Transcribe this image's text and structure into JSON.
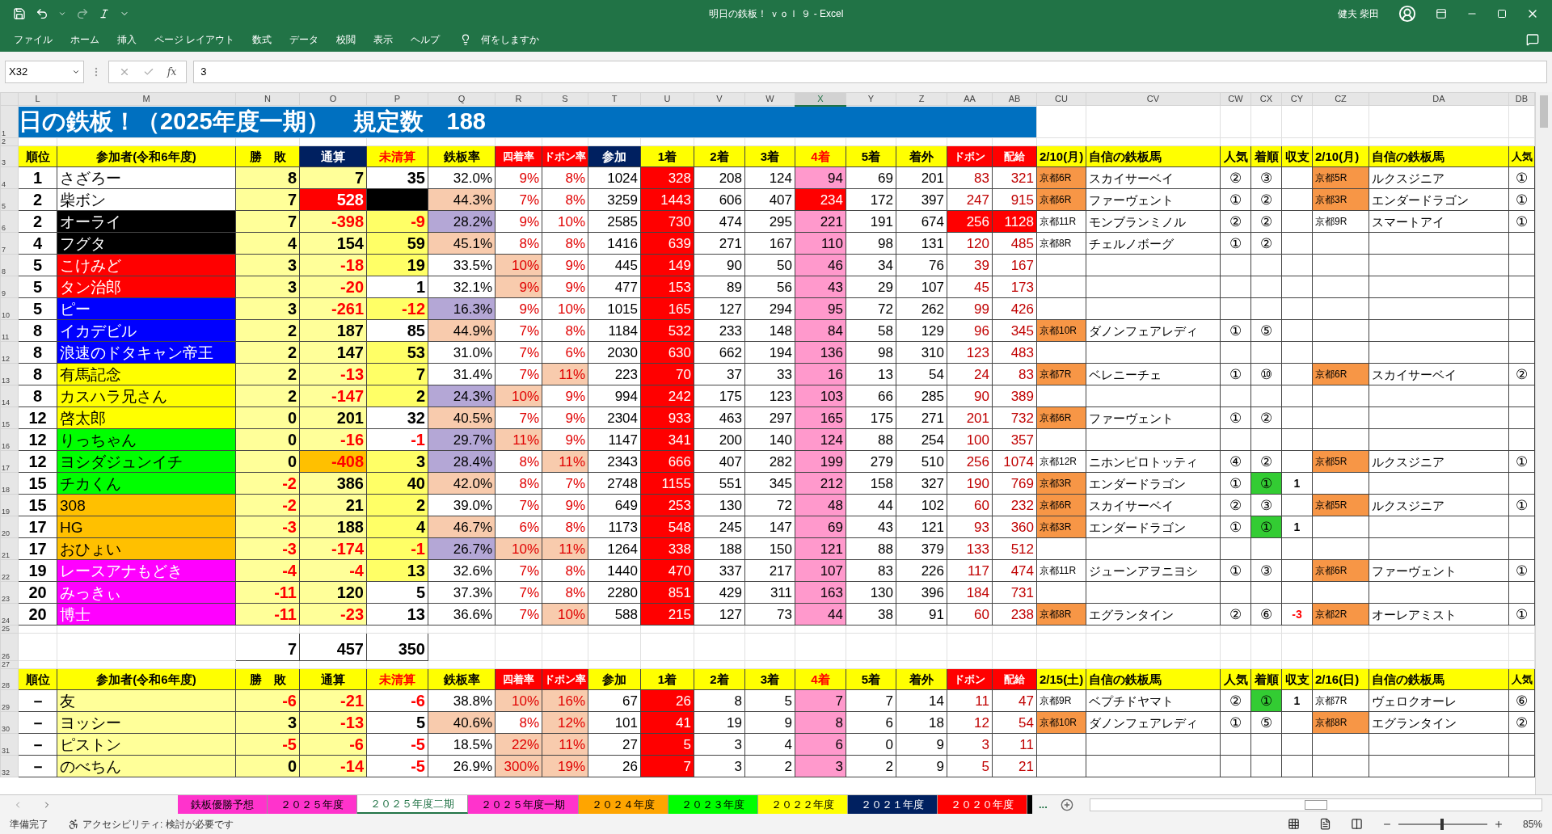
{
  "window": {
    "title": "明日の鉄板！ ｖｏｌ ９ - Excel",
    "user": "健夫 柴田"
  },
  "menu": [
    "ファイル",
    "ホーム",
    "挿入",
    "ページ レイアウト",
    "数式",
    "データ",
    "校閲",
    "表示",
    "ヘルプ"
  ],
  "tell_me": "何をしますか",
  "formula_bar": {
    "name_box": "X32",
    "fx": "fx",
    "value": "3"
  },
  "columns": [
    {
      "label": "L",
      "selected": false
    },
    {
      "label": "M",
      "selected": false
    },
    {
      "label": "N",
      "selected": false
    },
    {
      "label": "O",
      "selected": false
    },
    {
      "label": "P",
      "selected": false
    },
    {
      "label": "Q",
      "selected": false
    },
    {
      "label": "R",
      "selected": false
    },
    {
      "label": "S",
      "selected": false
    },
    {
      "label": "T",
      "selected": false
    },
    {
      "label": "U",
      "selected": false
    },
    {
      "label": "V",
      "selected": false
    },
    {
      "label": "W",
      "selected": false
    },
    {
      "label": "X",
      "selected": true
    },
    {
      "label": "Y",
      "selected": false
    },
    {
      "label": "Z",
      "selected": false
    },
    {
      "label": "AA",
      "selected": false
    },
    {
      "label": "AB",
      "selected": false
    },
    {
      "label": "CU",
      "selected": false
    },
    {
      "label": "CV",
      "selected": false
    },
    {
      "label": "CW",
      "selected": false
    },
    {
      "label": "CX",
      "selected": false
    },
    {
      "label": "CY",
      "selected": false
    },
    {
      "label": "CZ",
      "selected": false
    },
    {
      "label": "DA",
      "selected": false
    },
    {
      "label": "DB",
      "selected": false
    }
  ],
  "row_numbers": [
    "1",
    "2",
    "3",
    "4",
    "5",
    "6",
    "7",
    "8",
    "9",
    "10",
    "11",
    "12",
    "13",
    "14",
    "15",
    "16",
    "17",
    "18",
    "19",
    "20",
    "21",
    "22",
    "23",
    "24",
    "25",
    "26",
    "27",
    "28",
    "29",
    "30",
    "31",
    "32"
  ],
  "banner": "日の鉄板！（2025年度一期）　規定数　188",
  "header": [
    {
      "text": "順位",
      "color": "#ffff00",
      "accent": false
    },
    {
      "text": "参加者(令和6年度)",
      "color": "#ffff00",
      "accent": false
    },
    {
      "text": "勝　敗",
      "color": "#ffff00",
      "accent": false
    },
    {
      "text": "通算",
      "color": "#002060",
      "accent": false
    },
    {
      "text": "未清算",
      "color": "#ffff00",
      "accent": true
    },
    {
      "text": "鉄板率",
      "color": "#ffff00",
      "accent": false
    },
    {
      "text": "四着率",
      "color": "#ff0000",
      "accent": false
    },
    {
      "text": "ドボン率",
      "color": "#ff0000",
      "accent": false
    },
    {
      "text": "参加",
      "color": "#002060",
      "accent": false
    },
    {
      "text": "1着",
      "color": "#ffff00",
      "accent": false
    },
    {
      "text": "2着",
      "color": "#ffff00",
      "accent": false
    },
    {
      "text": "3着",
      "color": "#ffff00",
      "accent": false
    },
    {
      "text": "4着",
      "color": "#ffff00",
      "accent": true
    },
    {
      "text": "5着",
      "color": "#ffff00",
      "accent": false
    },
    {
      "text": "着外",
      "color": "#ffff00",
      "accent": false
    },
    {
      "text": "ドボン",
      "color": "#ff0000",
      "accent": false
    },
    {
      "text": "配給",
      "color": "#ff0000",
      "accent": false
    },
    {
      "text": "2/10(月)",
      "color": "#ffff00",
      "accent": false
    },
    {
      "text": "自信の鉄板馬",
      "color": "#ffff00",
      "accent": false
    },
    {
      "text": "人気",
      "color": "#ffff00",
      "accent": false
    },
    {
      "text": "着順",
      "color": "#ffff00",
      "accent": false
    },
    {
      "text": "収支",
      "color": "#ffff00",
      "accent": false
    },
    {
      "text": "2/10(月)",
      "color": "#ffff00",
      "accent": false
    },
    {
      "text": "自信の鉄板馬",
      "color": "#ffff00",
      "accent": false
    },
    {
      "text": "人気",
      "color": "#ffff00",
      "accent": false
    }
  ],
  "rows": [
    {
      "rank": "1",
      "name": {
        "text": "さざろー",
        "color": "#ffffff"
      },
      "win_loss": "8",
      "total": {
        "text": "7",
        "color": "#ffff99"
      },
      "unsettled": {
        "text": "35",
        "color": "#ffffff"
      },
      "rate": {
        "text": "32.0%",
        "color": "#ffffff"
      },
      "fourth_rate": {
        "text": "9%",
        "color": "#ffffff"
      },
      "dobon_rate": {
        "text": "8%",
        "color": "#ffffff"
      },
      "entries": "1024",
      "first": "328",
      "second": "208",
      "third": "124",
      "fourth": {
        "text": "94",
        "color": "#ff99cc"
      },
      "fifth": "69",
      "out": "201",
      "dobon": {
        "text": "83",
        "color": "#ffffff"
      },
      "payout": {
        "text": "321",
        "color": "#ffffff"
      },
      "picks": [
        {
          "race": {
            "text": "京都6R",
            "color": "#f79646"
          },
          "horse": "スカイサーベイ",
          "pop": "②",
          "result": {
            "text": "③",
            "color": "#ffffff"
          }
        },
        {
          "race": {
            "text": "京都5R",
            "color": "#f79646"
          },
          "horse": "ルクスジニア",
          "pop": "①"
        }
      ]
    },
    {
      "rank": "2",
      "name": {
        "text": "柴ボン",
        "color": "#ffffff"
      },
      "win_loss": "7",
      "total": {
        "text": "528",
        "color": "#ff0000"
      },
      "unsettled": {
        "color": "#000000"
      },
      "rate": {
        "text": "44.3%",
        "color": "#f8cbad"
      },
      "fourth_rate": {
        "text": "7%",
        "color": "#ffffff"
      },
      "dobon_rate": {
        "text": "8%",
        "color": "#ffffff"
      },
      "entries": "3259",
      "first": "1443",
      "second": "606",
      "third": "407",
      "fourth": {
        "text": "234",
        "color": "#ff0000"
      },
      "fifth": "172",
      "out": "397",
      "dobon": {
        "text": "247",
        "color": "#ffffff"
      },
      "payout": {
        "text": "915",
        "color": "#ffffff"
      },
      "picks": [
        {
          "race": {
            "text": "京都6R",
            "color": "#f79646"
          },
          "horse": "ファーヴェント",
          "pop": "①",
          "result": {
            "text": "②",
            "color": "#ffffff"
          }
        },
        {
          "race": {
            "text": "京都3R",
            "color": "#f79646"
          },
          "horse": "エンダードラゴン",
          "pop": "①"
        }
      ]
    },
    {
      "rank": "2",
      "name": {
        "text": "オーライ",
        "color": "#000000"
      },
      "win_loss": "7",
      "total": {
        "text": "-398",
        "color": "#ffff99"
      },
      "unsettled": {
        "text": "-9",
        "color": "#ffff66"
      },
      "rate": {
        "text": "28.2%",
        "color": "#b4a7d6"
      },
      "fourth_rate": {
        "text": "9%",
        "color": "#ffffff"
      },
      "dobon_rate": {
        "text": "10%",
        "color": "#ffffff"
      },
      "entries": "2585",
      "first": "730",
      "second": "474",
      "third": "295",
      "fourth": {
        "text": "221",
        "color": "#ff99cc"
      },
      "fifth": "191",
      "out": "674",
      "dobon": {
        "text": "256",
        "color": "#ff0000"
      },
      "payout": {
        "text": "1128",
        "color": "#ff0000"
      },
      "picks": [
        {
          "race": {
            "text": "京都11R",
            "color": "#ffffff"
          },
          "horse": "モンブランミノル",
          "pop": "②",
          "result": {
            "text": "②",
            "color": "#ffffff"
          }
        },
        {
          "race": {
            "text": "京都9R",
            "color": "#ffffff"
          },
          "horse": "スマートアイ",
          "pop": "①"
        }
      ]
    },
    {
      "rank": "4",
      "name": {
        "text": "フグタ",
        "color": "#000000"
      },
      "win_loss": "4",
      "total": {
        "text": "154",
        "color": "#ffff99"
      },
      "unsettled": {
        "text": "59",
        "color": "#ffff66"
      },
      "rate": {
        "text": "45.1%",
        "color": "#f8cbad"
      },
      "fourth_rate": {
        "text": "8%",
        "color": "#ffffff"
      },
      "dobon_rate": {
        "text": "8%",
        "color": "#ffffff"
      },
      "entries": "1416",
      "first": "639",
      "second": "271",
      "third": "167",
      "fourth": {
        "text": "110",
        "color": "#ff99cc"
      },
      "fifth": "98",
      "out": "131",
      "dobon": {
        "text": "120",
        "color": "#ffffff"
      },
      "payout": {
        "text": "485",
        "color": "#ffffff"
      },
      "picks": [
        {
          "race": {
            "text": "京都8R",
            "color": "#ffffff"
          },
          "horse": "チェルノボーグ",
          "pop": "①",
          "result": {
            "text": "②",
            "color": "#ffffff"
          }
        }
      ]
    },
    {
      "rank": "5",
      "name": {
        "text": "こけみど",
        "color": "#ff0000"
      },
      "win_loss": "3",
      "total": {
        "text": "-18",
        "color": "#ffff99"
      },
      "unsettled": {
        "text": "19",
        "color": "#ffff66"
      },
      "rate": {
        "text": "33.5%",
        "color": "#ffffff"
      },
      "fourth_rate": {
        "text": "10%",
        "color": "#f8cbad"
      },
      "dobon_rate": {
        "text": "9%",
        "color": "#ffffff"
      },
      "entries": "445",
      "first": "149",
      "second": "90",
      "third": "50",
      "fourth": {
        "text": "46",
        "color": "#ff99cc"
      },
      "fifth": "34",
      "out": "76",
      "dobon": {
        "text": "39",
        "color": "#ffffff"
      },
      "payout": {
        "text": "167",
        "color": "#ffffff"
      }
    },
    {
      "rank": "5",
      "name": {
        "text": "タン治郎",
        "color": "#ff0000"
      },
      "win_loss": "3",
      "total": {
        "text": "-20",
        "color": "#ffff99"
      },
      "unsettled": {
        "text": "1",
        "color": "#ffffff"
      },
      "rate": {
        "text": "32.1%",
        "color": "#ffffff"
      },
      "fourth_rate": {
        "text": "9%",
        "color": "#f8cbad"
      },
      "dobon_rate": {
        "text": "9%",
        "color": "#ffffff"
      },
      "entries": "477",
      "first": "153",
      "second": "89",
      "third": "56",
      "fourth": {
        "text": "43",
        "color": "#ff99cc"
      },
      "fifth": "29",
      "out": "107",
      "dobon": {
        "text": "45",
        "color": "#ffffff"
      },
      "payout": {
        "text": "173",
        "color": "#ffffff"
      }
    },
    {
      "rank": "5",
      "name": {
        "text": "ピー",
        "color": "#0000ff"
      },
      "win_loss": "3",
      "total": {
        "text": "-261",
        "color": "#ffff99"
      },
      "unsettled": {
        "text": "-12",
        "color": "#ffff66"
      },
      "rate": {
        "text": "16.3%",
        "color": "#b4a7d6"
      },
      "fourth_rate": {
        "text": "9%",
        "color": "#ffffff"
      },
      "dobon_rate": {
        "text": "10%",
        "color": "#ffffff"
      },
      "entries": "1015",
      "first": "165",
      "second": "127",
      "third": "294",
      "fourth": {
        "text": "95",
        "color": "#ff99cc"
      },
      "fifth": "72",
      "out": "262",
      "dobon": {
        "text": "99",
        "color": "#ffffff"
      },
      "payout": {
        "text": "426",
        "color": "#ffffff"
      }
    },
    {
      "rank": "8",
      "name": {
        "text": "イカデビル",
        "color": "#0000ff"
      },
      "win_loss": "2",
      "total": {
        "text": "187",
        "color": "#ffff99"
      },
      "unsettled": {
        "text": "85",
        "color": "#ffffff"
      },
      "rate": {
        "text": "44.9%",
        "color": "#f8cbad"
      },
      "fourth_rate": {
        "text": "7%",
        "color": "#ffffff"
      },
      "dobon_rate": {
        "text": "8%",
        "color": "#ffffff"
      },
      "entries": "1184",
      "first": "532",
      "second": "233",
      "third": "148",
      "fourth": {
        "text": "84",
        "color": "#ff99cc"
      },
      "fifth": "58",
      "out": "129",
      "dobon": {
        "text": "96",
        "color": "#ffffff"
      },
      "payout": {
        "text": "345",
        "color": "#ffffff"
      },
      "picks": [
        {
          "race": {
            "text": "京都10R",
            "color": "#f79646"
          },
          "horse": "ダノンフェアレディ",
          "pop": "①",
          "result": {
            "text": "⑤",
            "color": "#ffffff"
          }
        }
      ]
    },
    {
      "rank": "8",
      "name": {
        "text": "浪速のドタキャン帝王",
        "color": "#0000ff"
      },
      "win_loss": "2",
      "total": {
        "text": "147",
        "color": "#ffff99"
      },
      "unsettled": {
        "text": "53",
        "color": "#ffff66"
      },
      "rate": {
        "text": "31.0%",
        "color": "#ffffff"
      },
      "fourth_rate": {
        "text": "7%",
        "color": "#ffffff"
      },
      "dobon_rate": {
        "text": "6%",
        "color": "#ffffff"
      },
      "entries": "2030",
      "first": "630",
      "second": "662",
      "third": "194",
      "fourth": {
        "text": "136",
        "color": "#ff99cc"
      },
      "fifth": "98",
      "out": "310",
      "dobon": {
        "text": "123",
        "color": "#ffffff"
      },
      "payout": {
        "text": "483",
        "color": "#ffffff"
      }
    },
    {
      "rank": "8",
      "name": {
        "text": "有馬記念",
        "color": "#ffff00"
      },
      "win_loss": "2",
      "total": {
        "text": "-13",
        "color": "#ffff99"
      },
      "unsettled": {
        "text": "7",
        "color": "#ffff66"
      },
      "rate": {
        "text": "31.4%",
        "color": "#ffffff"
      },
      "fourth_rate": {
        "text": "7%",
        "color": "#ffffff"
      },
      "dobon_rate": {
        "text": "11%",
        "color": "#f8cbad"
      },
      "entries": "223",
      "first": "70",
      "second": "37",
      "third": "33",
      "fourth": {
        "text": "16",
        "color": "#ff99cc"
      },
      "fifth": "13",
      "out": "54",
      "dobon": {
        "text": "24",
        "color": "#ffffff"
      },
      "payout": {
        "text": "83",
        "color": "#ffffff"
      },
      "picks": [
        {
          "race": {
            "text": "京都7R",
            "color": "#f79646"
          },
          "horse": "ベレニーチェ",
          "pop": "①",
          "result": {
            "text": "⑩",
            "color": "#ffffff"
          }
        },
        {
          "race": {
            "text": "京都6R",
            "color": "#f79646"
          },
          "horse": "スカイサーベイ",
          "pop": "②"
        }
      ]
    },
    {
      "rank": "8",
      "name": {
        "text": "カスハラ兄さん",
        "color": "#ffff00"
      },
      "win_loss": "2",
      "total": {
        "text": "-147",
        "color": "#ffff99"
      },
      "unsettled": {
        "text": "2",
        "color": "#ffff66"
      },
      "rate": {
        "text": "24.3%",
        "color": "#b4a7d6"
      },
      "fourth_rate": {
        "text": "10%",
        "color": "#f8cbad"
      },
      "dobon_rate": {
        "text": "9%",
        "color": "#ffffff"
      },
      "entries": "994",
      "first": "242",
      "second": "175",
      "third": "123",
      "fourth": {
        "text": "103",
        "color": "#ff99cc"
      },
      "fifth": "66",
      "out": "285",
      "dobon": {
        "text": "90",
        "color": "#ffffff"
      },
      "payout": {
        "text": "389",
        "color": "#ffffff"
      }
    },
    {
      "rank": "12",
      "name": {
        "text": "啓太郎",
        "color": "#ffff00"
      },
      "win_loss": "0",
      "total": {
        "text": "201",
        "color": "#ffff99"
      },
      "unsettled": {
        "text": "32",
        "color": "#ffffff"
      },
      "rate": {
        "text": "40.5%",
        "color": "#f8cbad"
      },
      "fourth_rate": {
        "text": "7%",
        "color": "#ffffff"
      },
      "dobon_rate": {
        "text": "9%",
        "color": "#ffffff"
      },
      "entries": "2304",
      "first": "933",
      "second": "463",
      "third": "297",
      "fourth": {
        "text": "165",
        "color": "#ff99cc"
      },
      "fifth": "175",
      "out": "271",
      "dobon": {
        "text": "201",
        "color": "#ffffff"
      },
      "payout": {
        "text": "732",
        "color": "#ffffff"
      },
      "picks": [
        {
          "race": {
            "text": "京都6R",
            "color": "#f79646"
          },
          "horse": "ファーヴェント",
          "pop": "①",
          "result": {
            "text": "②",
            "color": "#ffffff"
          }
        }
      ]
    },
    {
      "rank": "12",
      "name": {
        "text": "りっちゃん",
        "color": "#00ff00"
      },
      "win_loss": "0",
      "total": {
        "text": "-16",
        "color": "#ffff99"
      },
      "unsettled": {
        "text": "-1",
        "color": "#ffffff"
      },
      "rate": {
        "text": "29.7%",
        "color": "#b4a7d6"
      },
      "fourth_rate": {
        "text": "11%",
        "color": "#f8cbad"
      },
      "dobon_rate": {
        "text": "9%",
        "color": "#ffffff"
      },
      "entries": "1147",
      "first": "341",
      "second": "200",
      "third": "140",
      "fourth": {
        "text": "124",
        "color": "#ff99cc"
      },
      "fifth": "88",
      "out": "254",
      "dobon": {
        "text": "100",
        "color": "#ffffff"
      },
      "payout": {
        "text": "357",
        "color": "#ffffff"
      }
    },
    {
      "rank": "12",
      "name": {
        "text": "ヨシダジュンイチ",
        "color": "#00ff00"
      },
      "win_loss": "0",
      "total": {
        "text": "-408",
        "color": "#ffc000"
      },
      "unsettled": {
        "text": "3",
        "color": "#ffff66"
      },
      "rate": {
        "text": "28.4%",
        "color": "#b4a7d6"
      },
      "fourth_rate": {
        "text": "8%",
        "color": "#ffffff"
      },
      "dobon_rate": {
        "text": "11%",
        "color": "#f8cbad"
      },
      "entries": "2343",
      "first": "666",
      "second": "407",
      "third": "282",
      "fourth": {
        "text": "199",
        "color": "#ff99cc"
      },
      "fifth": "279",
      "out": "510",
      "dobon": {
        "text": "256",
        "color": "#ffffff"
      },
      "payout": {
        "text": "1074",
        "color": "#ffffff"
      },
      "picks": [
        {
          "race": {
            "text": "京都12R",
            "color": "#ffffff"
          },
          "horse": "ニホンピロトッティ",
          "pop": "④",
          "result": {
            "text": "②",
            "color": "#ffffff"
          }
        },
        {
          "race": {
            "text": "京都5R",
            "color": "#f79646"
          },
          "horse": "ルクスジニア",
          "pop": "①"
        }
      ]
    },
    {
      "rank": "15",
      "name": {
        "text": "チカくん",
        "color": "#00ff00"
      },
      "win_loss": "-2",
      "total": {
        "text": "386",
        "color": "#ffff99"
      },
      "unsettled": {
        "text": "40",
        "color": "#ffff66"
      },
      "rate": {
        "text": "42.0%",
        "color": "#f8cbad"
      },
      "fourth_rate": {
        "text": "8%",
        "color": "#ffffff"
      },
      "dobon_rate": {
        "text": "7%",
        "color": "#ffffff"
      },
      "entries": "2748",
      "first": "1155",
      "second": "551",
      "third": "345",
      "fourth": {
        "text": "212",
        "color": "#ff99cc"
      },
      "fifth": "158",
      "out": "327",
      "dobon": {
        "text": "190",
        "color": "#ffffff"
      },
      "payout": {
        "text": "769",
        "color": "#ffffff"
      },
      "picks": [
        {
          "race": {
            "text": "京都3R",
            "color": "#f79646"
          },
          "horse": "エンダードラゴン",
          "pop": "①",
          "result": {
            "text": "①",
            "color": "#33cc33"
          },
          "balance": "1"
        }
      ]
    },
    {
      "rank": "15",
      "name": {
        "text": "308",
        "color": "#ffc000"
      },
      "win_loss": "-2",
      "total": {
        "text": "21",
        "color": "#ffff99"
      },
      "unsettled": {
        "text": "2",
        "color": "#ffff66"
      },
      "rate": {
        "text": "39.0%",
        "color": "#ffffff"
      },
      "fourth_rate": {
        "text": "7%",
        "color": "#ffffff"
      },
      "dobon_rate": {
        "text": "9%",
        "color": "#ffffff"
      },
      "entries": "649",
      "first": "253",
      "second": "130",
      "third": "72",
      "fourth": {
        "text": "48",
        "color": "#ff99cc"
      },
      "fifth": "44",
      "out": "102",
      "dobon": {
        "text": "60",
        "color": "#ffffff"
      },
      "payout": {
        "text": "232",
        "color": "#ffffff"
      },
      "picks": [
        {
          "race": {
            "text": "京都6R",
            "color": "#f79646"
          },
          "horse": "スカイサーベイ",
          "pop": "②",
          "result": {
            "text": "③",
            "color": "#ffffff"
          }
        },
        {
          "race": {
            "text": "京都5R",
            "color": "#f79646"
          },
          "horse": "ルクスジニア",
          "pop": "①"
        }
      ]
    },
    {
      "rank": "17",
      "name": {
        "text": "HG",
        "color": "#ffc000"
      },
      "win_loss": "-3",
      "total": {
        "text": "188",
        "color": "#ffff99"
      },
      "unsettled": {
        "text": "4",
        "color": "#ffff66"
      },
      "rate": {
        "text": "46.7%",
        "color": "#f8cbad"
      },
      "fourth_rate": {
        "text": "6%",
        "color": "#ffffff"
      },
      "dobon_rate": {
        "text": "8%",
        "color": "#ffffff"
      },
      "entries": "1173",
      "first": "548",
      "second": "245",
      "third": "147",
      "fourth": {
        "text": "69",
        "color": "#ff99cc"
      },
      "fifth": "43",
      "out": "121",
      "dobon": {
        "text": "93",
        "color": "#ffffff"
      },
      "payout": {
        "text": "360",
        "color": "#ffffff"
      },
      "picks": [
        {
          "race": {
            "text": "京都3R",
            "color": "#f79646"
          },
          "horse": "エンダードラゴン",
          "pop": "①",
          "result": {
            "text": "①",
            "color": "#33cc33"
          },
          "balance": "1"
        }
      ]
    },
    {
      "rank": "17",
      "name": {
        "text": "おひょい",
        "color": "#ffc000"
      },
      "win_loss": "-3",
      "total": {
        "text": "-174",
        "color": "#ffff99"
      },
      "unsettled": {
        "text": "-1",
        "color": "#ffff66"
      },
      "rate": {
        "text": "26.7%",
        "color": "#b4a7d6"
      },
      "fourth_rate": {
        "text": "10%",
        "color": "#f8cbad"
      },
      "dobon_rate": {
        "text": "11%",
        "color": "#f8cbad"
      },
      "entries": "1264",
      "first": "338",
      "second": "188",
      "third": "150",
      "fourth": {
        "text": "121",
        "color": "#ff99cc"
      },
      "fifth": "88",
      "out": "379",
      "dobon": {
        "text": "133",
        "color": "#ffffff"
      },
      "payout": {
        "text": "512",
        "color": "#ffffff"
      }
    },
    {
      "rank": "19",
      "name": {
        "text": "レースアナもどき",
        "color": "#ff00ff"
      },
      "win_loss": "-4",
      "total": {
        "text": "-4",
        "color": "#ffff99"
      },
      "unsettled": {
        "text": "13",
        "color": "#ffff66"
      },
      "rate": {
        "text": "32.6%",
        "color": "#ffffff"
      },
      "fourth_rate": {
        "text": "7%",
        "color": "#ffffff"
      },
      "dobon_rate": {
        "text": "8%",
        "color": "#ffffff"
      },
      "entries": "1440",
      "first": "470",
      "second": "337",
      "third": "217",
      "fourth": {
        "text": "107",
        "color": "#ff99cc"
      },
      "fifth": "83",
      "out": "226",
      "dobon": {
        "text": "117",
        "color": "#ffffff"
      },
      "payout": {
        "text": "474",
        "color": "#ffffff"
      },
      "picks": [
        {
          "race": {
            "text": "京都11R",
            "color": "#ffffff"
          },
          "horse": "ジューンアヲニヨシ",
          "pop": "①",
          "result": {
            "text": "③",
            "color": "#ffffff"
          }
        },
        {
          "race": {
            "text": "京都6R",
            "color": "#f79646"
          },
          "horse": "ファーヴェント",
          "pop": "①"
        }
      ]
    },
    {
      "rank": "20",
      "name": {
        "text": "みっきぃ",
        "color": "#ff00ff"
      },
      "win_loss": "-11",
      "total": {
        "text": "120",
        "color": "#ffff99"
      },
      "unsettled": {
        "text": "5",
        "color": "#ffffff"
      },
      "rate": {
        "text": "37.3%",
        "color": "#ffffff"
      },
      "fourth_rate": {
        "text": "7%",
        "color": "#ffffff"
      },
      "dobon_rate": {
        "text": "8%",
        "color": "#ffffff"
      },
      "entries": "2280",
      "first": "851",
      "second": "429",
      "third": "311",
      "fourth": {
        "text": "163",
        "color": "#ff99cc"
      },
      "fifth": "130",
      "out": "396",
      "dobon": {
        "text": "184",
        "color": "#ffffff"
      },
      "payout": {
        "text": "731",
        "color": "#ffffff"
      }
    },
    {
      "rank": "20",
      "name": {
        "text": "博士",
        "color": "#ff00ff"
      },
      "win_loss": "-11",
      "total": {
        "text": "-23",
        "color": "#ffff99"
      },
      "unsettled": {
        "text": "13",
        "color": "#ffffff"
      },
      "rate": {
        "text": "36.6%",
        "color": "#ffffff"
      },
      "fourth_rate": {
        "text": "7%",
        "color": "#ffffff"
      },
      "dobon_rate": {
        "text": "10%",
        "color": "#f8cbad"
      },
      "entries": "588",
      "first": "215",
      "second": "127",
      "third": "73",
      "fourth": {
        "text": "44",
        "color": "#ff99cc"
      },
      "fifth": "38",
      "out": "91",
      "dobon": {
        "text": "60",
        "color": "#ffffff"
      },
      "payout": {
        "text": "238",
        "color": "#ffffff"
      },
      "picks": [
        {
          "race": {
            "text": "京都8R",
            "color": "#f79646"
          },
          "horse": "エグランタイン",
          "pop": "②",
          "result": {
            "text": "⑥",
            "color": "#ffffff"
          },
          "balance": "-3"
        },
        {
          "race": {
            "text": "京都2R",
            "color": "#f79646"
          },
          "horse": "オーレアミスト",
          "pop": "①"
        }
      ]
    }
  ],
  "totals": [
    "7",
    "457",
    "350"
  ],
  "header_2": [
    {
      "text": "順位",
      "color": "#ffff00",
      "accent": false
    },
    {
      "text": "参加者(令和6年度)",
      "color": "#ffff00",
      "accent": false
    },
    {
      "text": "勝　敗",
      "color": "#ffff00",
      "accent": false
    },
    {
      "text": "通算",
      "color": "#ffff00",
      "accent": false
    },
    {
      "text": "未清算",
      "color": "#ffff00",
      "accent": true
    },
    {
      "text": "鉄板率",
      "color": "#ffff00",
      "accent": false
    },
    {
      "text": "四着率",
      "color": "#ff0000",
      "accent": false
    },
    {
      "text": "ドボン率",
      "color": "#ff0000",
      "accent": false
    },
    {
      "text": "参加",
      "color": "#ffff00",
      "accent": false
    },
    {
      "text": "1着",
      "color": "#ffff00",
      "accent": false
    },
    {
      "text": "2着",
      "color": "#ffff00",
      "accent": false
    },
    {
      "text": "3着",
      "color": "#ffff00",
      "accent": false
    },
    {
      "text": "4着",
      "color": "#ffff00",
      "accent": true
    },
    {
      "text": "5着",
      "color": "#ffff00",
      "accent": false
    },
    {
      "text": "着外",
      "color": "#ffff00",
      "accent": false
    },
    {
      "text": "ドボン",
      "color": "#ff0000",
      "accent": false
    },
    {
      "text": "配給",
      "color": "#ff0000",
      "accent": false
    },
    {
      "text": "2/15(土)",
      "color": "#ffff00",
      "accent": false
    },
    {
      "text": "自信の鉄板馬",
      "color": "#ffff00",
      "accent": false
    },
    {
      "text": "人気",
      "color": "#ffff00",
      "accent": false
    },
    {
      "text": "着順",
      "color": "#ffff00",
      "accent": false
    },
    {
      "text": "収支",
      "color": "#ffff00",
      "accent": false
    },
    {
      "text": "2/16(日)",
      "color": "#ffff00",
      "accent": false
    },
    {
      "text": "自信の鉄板馬",
      "color": "#ffff00",
      "accent": false
    },
    {
      "text": "人気",
      "color": "#ffff00",
      "accent": false
    }
  ],
  "rows_2": [
    {
      "rank": "－",
      "name": {
        "text": "友",
        "color": "#ffff99"
      },
      "win_loss": "-6",
      "total": {
        "text": "-21",
        "color": "#ffff99"
      },
      "unsettled": {
        "text": "-6",
        "color": "#ffffff"
      },
      "rate": {
        "text": "38.8%",
        "color": "#ffffff"
      },
      "fourth_rate": {
        "text": "10%",
        "color": "#f8cbad"
      },
      "dobon_rate": {
        "text": "16%",
        "color": "#f8cbad"
      },
      "entries": "67",
      "first": "26",
      "second": "8",
      "third": "5",
      "fourth": {
        "text": "7",
        "color": "#ff99cc"
      },
      "fifth": "7",
      "out": "14",
      "dobon": {
        "text": "11",
        "color": "#ffffff"
      },
      "payout": {
        "text": "47",
        "color": "#ffffff"
      },
      "picks": [
        {
          "race": {
            "text": "京都9R",
            "color": "#ffffff"
          },
          "horse": "ベプチドヤマト",
          "pop": "②",
          "result": {
            "text": "①",
            "color": "#33cc33"
          },
          "balance": "1"
        },
        {
          "race": {
            "text": "京都7R",
            "color": "#ffffff"
          },
          "horse": "ヴェロクオーレ",
          "pop": "⑥"
        }
      ]
    },
    {
      "rank": "－",
      "name": {
        "text": "ヨッシー",
        "color": "#ffff99"
      },
      "win_loss": "3",
      "total": {
        "text": "-13",
        "color": "#ffff99"
      },
      "unsettled": {
        "text": "5",
        "color": "#ffffff"
      },
      "rate": {
        "text": "40.6%",
        "color": "#f8cbad"
      },
      "fourth_rate": {
        "text": "8%",
        "color": "#ffffff"
      },
      "dobon_rate": {
        "text": "12%",
        "color": "#f8cbad"
      },
      "entries": "101",
      "first": "41",
      "second": "19",
      "third": "9",
      "fourth": {
        "text": "8",
        "color": "#ff99cc"
      },
      "fifth": "6",
      "out": "18",
      "dobon": {
        "text": "12",
        "color": "#ffffff"
      },
      "payout": {
        "text": "54",
        "color": "#ffffff"
      },
      "picks": [
        {
          "race": {
            "text": "京都10R",
            "color": "#f79646"
          },
          "horse": "ダノンフェアレディ",
          "pop": "①",
          "result": {
            "text": "⑤",
            "color": "#ffffff"
          }
        },
        {
          "race": {
            "text": "京都8R",
            "color": "#f79646"
          },
          "horse": "エグランタイン",
          "pop": "②"
        }
      ]
    },
    {
      "rank": "－",
      "name": {
        "text": "ピストン",
        "color": "#ffff99"
      },
      "win_loss": "-5",
      "total": {
        "text": "-6",
        "color": "#ffff99"
      },
      "unsettled": {
        "text": "-5",
        "color": "#ffffff"
      },
      "rate": {
        "text": "18.5%",
        "color": "#ffffff"
      },
      "fourth_rate": {
        "text": "22%",
        "color": "#f8cbad"
      },
      "dobon_rate": {
        "text": "11%",
        "color": "#f8cbad"
      },
      "entries": "27",
      "first": "5",
      "second": "3",
      "third": "4",
      "fourth": {
        "text": "6",
        "color": "#ff99cc"
      },
      "fifth": "0",
      "out": "9",
      "dobon": {
        "text": "3",
        "color": "#ffffff"
      },
      "payout": {
        "text": "11",
        "color": "#ffffff"
      }
    },
    {
      "rank": "－",
      "name": {
        "text": "のべちん",
        "color": "#ffff99"
      },
      "win_loss": "0",
      "total": {
        "text": "-14",
        "color": "#ffff99"
      },
      "unsettled": {
        "text": "-5",
        "color": "#ffffff"
      },
      "rate": {
        "text": "26.9%",
        "color": "#ffffff"
      },
      "fourth_rate": {
        "text": "300%",
        "color": "#f8cbad"
      },
      "dobon_rate": {
        "text": "19%",
        "color": "#f8cbad"
      },
      "entries": "26",
      "first": "7",
      "second": "3",
      "third": "2",
      "fourth": {
        "text": "3",
        "color": "#ff99cc"
      },
      "fifth": "2",
      "out": "9",
      "dobon": {
        "text": "5",
        "color": "#ffffff"
      },
      "payout": {
        "text": "21",
        "color": "#ffffff"
      }
    }
  ],
  "sheet_tabs": [
    {
      "label": "鉄板優勝予想",
      "color": "#ff33cc",
      "selected": false
    },
    {
      "label": "２０２５年度",
      "color": "#ff33cc",
      "selected": false
    },
    {
      "label": "２０２５年度二期",
      "color": "#ffffff",
      "selected": true
    },
    {
      "label": "２０２５年度一期",
      "color": "#ff33cc",
      "selected": false
    },
    {
      "label": "２０２４年度",
      "color": "#ffa500",
      "selected": false
    },
    {
      "label": "２０２３年度",
      "color": "#00ff00",
      "selected": false
    },
    {
      "label": "２０２２年度",
      "color": "#ffff00",
      "selected": false
    },
    {
      "label": "２０２１年度",
      "color": "#002060",
      "selected": false
    },
    {
      "label": "２０２０年度",
      "color": "#ff0000",
      "selected": false
    }
  ],
  "tabs_more": "...",
  "status_bar": {
    "ready": "準備完了",
    "accessibility": "アクセシビリティ: 検討が必要です",
    "zoom": "85%",
    "zoom_slider": {
      "level": 0.47
    }
  }
}
